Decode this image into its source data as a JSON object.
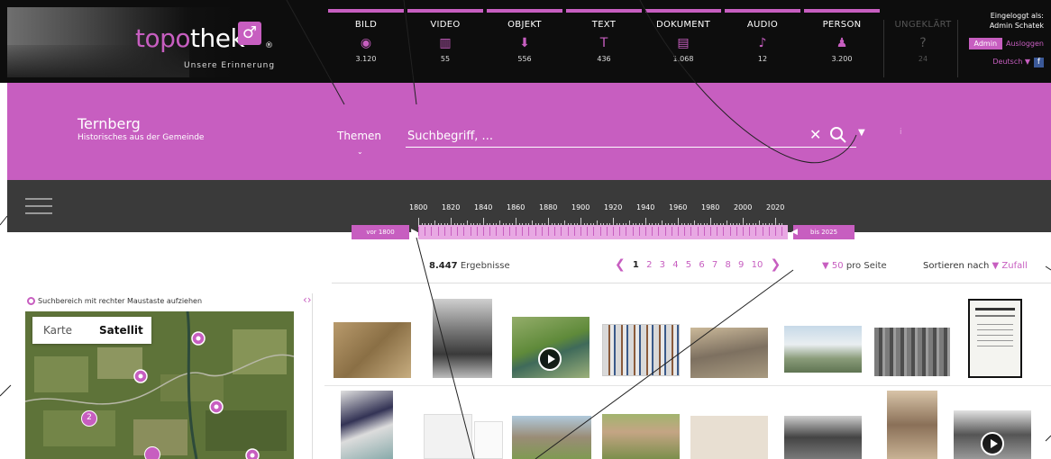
{
  "brand": {
    "name_part1": "topo",
    "name_part2": "thek",
    "registered": "®",
    "tagline": "Unsere Erinnerung"
  },
  "categories": [
    {
      "label": "BILD",
      "count": "3.120",
      "icon": "circle-icon"
    },
    {
      "label": "VIDEO",
      "count": "55",
      "icon": "film-icon"
    },
    {
      "label": "OBJEKT",
      "count": "556",
      "icon": "shovel-icon"
    },
    {
      "label": "TEXT",
      "count": "436",
      "icon": "text-t-icon"
    },
    {
      "label": "DOKUMENT",
      "count": "1.068",
      "icon": "document-icon"
    },
    {
      "label": "AUDIO",
      "count": "12",
      "icon": "music-note-icon"
    },
    {
      "label": "PERSON",
      "count": "3.200",
      "icon": "person-icon"
    },
    {
      "label": "UNGEKLÄRT",
      "count": "24",
      "icon": "question-icon"
    }
  ],
  "login": {
    "line1": "Eingeloggt als:",
    "line2": "Admin Schatek",
    "admin_label": "Admin",
    "logout_label": "Ausloggen",
    "language": "Deutsch"
  },
  "place": {
    "name": "Ternberg",
    "subtitle": "Historisches aus der Gemeinde"
  },
  "search": {
    "themes_label": "Themen",
    "placeholder": "Suchbegriff, ...",
    "info": "i"
  },
  "timeline": {
    "years": [
      "1800",
      "1820",
      "1840",
      "1860",
      "1880",
      "1900",
      "1920",
      "1940",
      "1960",
      "1980",
      "2000",
      "2020"
    ],
    "from_label": "vor 1800",
    "to_label": "bis 2025"
  },
  "results": {
    "count": "8.447",
    "label": "Ergebnisse",
    "pages": [
      "1",
      "2",
      "3",
      "4",
      "5",
      "6",
      "7",
      "8",
      "9",
      "10"
    ],
    "current_page": "1",
    "per_page_value": "50",
    "per_page_label": "pro Seite",
    "sort_label": "Sortieren nach",
    "sort_value": "Zufall"
  },
  "map": {
    "hint": "Suchbereich mit rechter Maustaste aufziehen",
    "tab_map": "Karte",
    "tab_satellite": "Satellit",
    "cluster_label": "2"
  },
  "colors": {
    "accent": "#c75ec0",
    "dark_band": "#3a3a3a",
    "top_bar": "#0d0d0d"
  }
}
